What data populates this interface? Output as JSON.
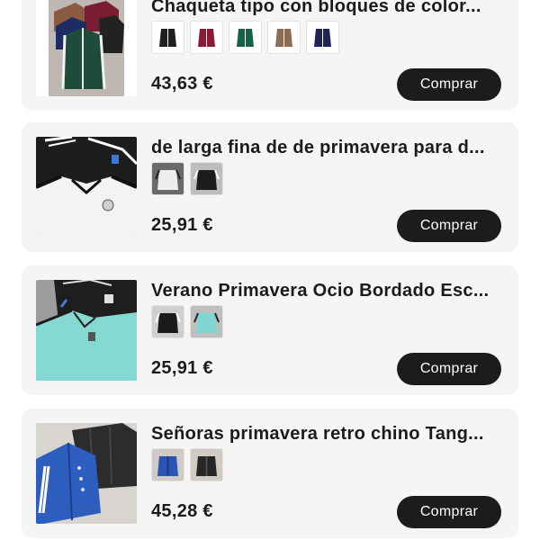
{
  "products": [
    {
      "title": "Chaqueta tipo con bloques de color...",
      "price": "43,63 €",
      "buy_label": "Comprar",
      "variant_colors": [
        "#1e1e1e",
        "#8b1a33",
        "#15614c",
        "#8d6a52",
        "#1f2355"
      ]
    },
    {
      "title": "de larga fina de de primavera para d...",
      "price": "25,91 €",
      "buy_label": "Comprar",
      "variant_colors": [
        "#eeeeee",
        "#1c1c1c"
      ]
    },
    {
      "title": "Verano Primavera Ocio Bordado Esc...",
      "price": "25,91 €",
      "buy_label": "Comprar",
      "variant_colors": [
        "#1b1b1b",
        "#7fd6d2"
      ]
    },
    {
      "title": "Señoras primavera retro chino Tang...",
      "price": "45,28 €",
      "buy_label": "Comprar",
      "variant_colors": [
        "#2a55b5",
        "#262626"
      ]
    }
  ]
}
